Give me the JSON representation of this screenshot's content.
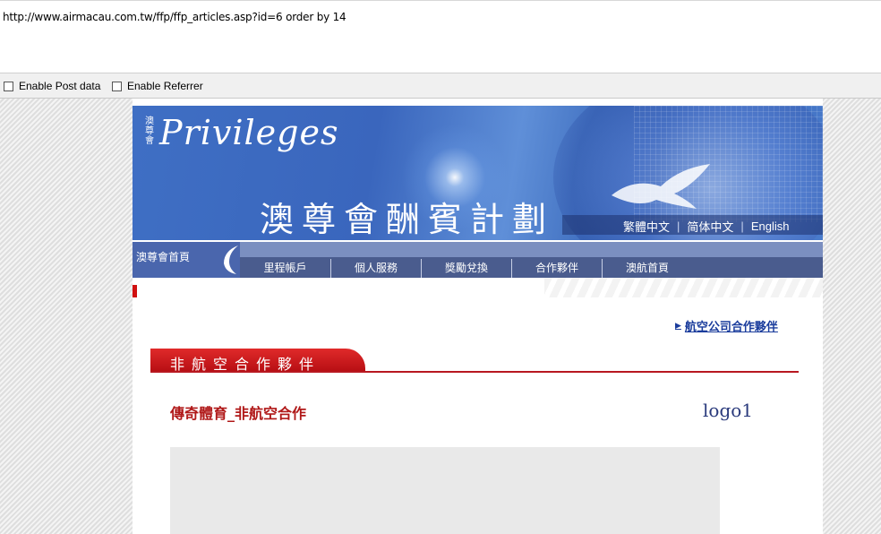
{
  "browser": {
    "url": "http://www.airmacau.com.tw/ffp/ffp_articles.asp?id=6 order by 14",
    "options": [
      {
        "label": "Enable Post data",
        "checked": false
      },
      {
        "label": "Enable Referrer",
        "checked": false
      }
    ]
  },
  "banner": {
    "logo_small": "澳尊會",
    "logo_script": "Privileges",
    "title": "澳尊會酬賓計劃",
    "languages": [
      "繁體中文",
      "简体中文",
      "English"
    ],
    "separator": "|"
  },
  "nav": {
    "home": "澳尊會首頁",
    "items": [
      "里程帳戶",
      "個人服務",
      "獎勵兌換",
      "合作夥伴",
      "澳航首頁"
    ]
  },
  "main": {
    "partner_link": "航空公司合作夥伴",
    "section_title": "非航空合作夥伴",
    "article_title": "傳奇體育_非航空合作",
    "logo_text": "logo1"
  }
}
